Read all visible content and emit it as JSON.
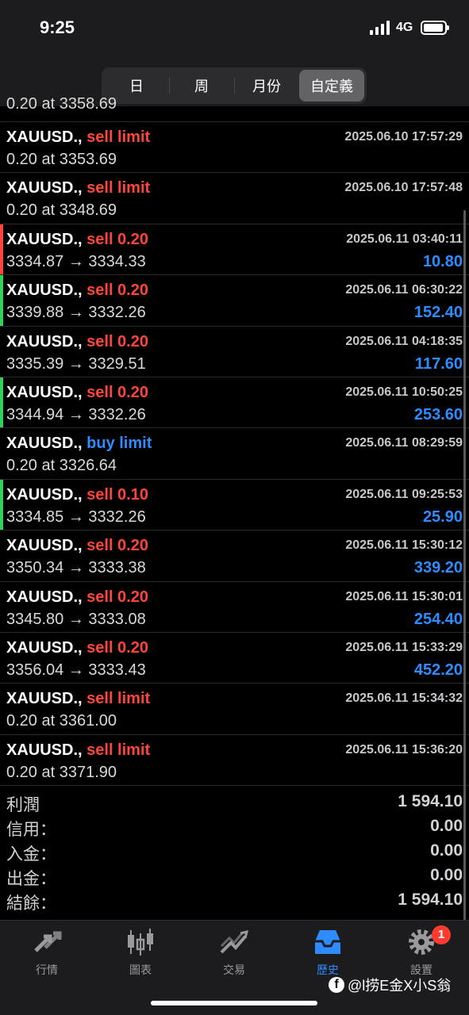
{
  "status_bar": {
    "time": "9:25",
    "network": "4G"
  },
  "segments": [
    {
      "label": "日",
      "active": false
    },
    {
      "label": "周",
      "active": false
    },
    {
      "label": "月份",
      "active": false
    },
    {
      "label": "自定義",
      "active": true
    }
  ],
  "partial_row": {
    "line2": "0.20 at 3358.69"
  },
  "rows": [
    {
      "symbol": "XAUUSD.,",
      "type": "sell limit",
      "type_color": "red",
      "time": "2025.06.10 17:57:29",
      "line2": "0.20 at 3353.69",
      "profit": "",
      "bar": ""
    },
    {
      "symbol": "XAUUSD.,",
      "type": "sell limit",
      "type_color": "red",
      "time": "2025.06.10 17:57:48",
      "line2": "0.20 at 3348.69",
      "profit": "",
      "bar": ""
    },
    {
      "symbol": "XAUUSD.,",
      "type": "sell 0.20",
      "type_color": "red",
      "time": "2025.06.11 03:40:11",
      "line2": "3334.87 → 3334.33",
      "profit": "10.80",
      "bar": "#ff453a"
    },
    {
      "symbol": "XAUUSD.,",
      "type": "sell 0.20",
      "type_color": "red",
      "time": "2025.06.11 06:30:22",
      "line2": "3339.88 → 3332.26",
      "profit": "152.40",
      "bar": "#30d158"
    },
    {
      "symbol": "XAUUSD.,",
      "type": "sell 0.20",
      "type_color": "red",
      "time": "2025.06.11 04:18:35",
      "line2": "3335.39 → 3329.51",
      "profit": "117.60",
      "bar": ""
    },
    {
      "symbol": "XAUUSD.,",
      "type": "sell 0.20",
      "type_color": "red",
      "time": "2025.06.11 10:50:25",
      "line2": "3344.94 → 3332.26",
      "profit": "253.60",
      "bar": "#30d158"
    },
    {
      "symbol": "XAUUSD.,",
      "type": "buy limit",
      "type_color": "blue",
      "time": "2025.06.11 08:29:59",
      "line2": "0.20 at 3326.64",
      "profit": "",
      "bar": ""
    },
    {
      "symbol": "XAUUSD.,",
      "type": "sell 0.10",
      "type_color": "red",
      "time": "2025.06.11 09:25:53",
      "line2": "3334.85 → 3332.26",
      "profit": "25.90",
      "bar": "#30d158"
    },
    {
      "symbol": "XAUUSD.,",
      "type": "sell 0.20",
      "type_color": "red",
      "time": "2025.06.11 15:30:12",
      "line2": "3350.34 → 3333.38",
      "profit": "339.20",
      "bar": ""
    },
    {
      "symbol": "XAUUSD.,",
      "type": "sell 0.20",
      "type_color": "red",
      "time": "2025.06.11 15:30:01",
      "line2": "3345.80 → 3333.08",
      "profit": "254.40",
      "bar": ""
    },
    {
      "symbol": "XAUUSD.,",
      "type": "sell 0.20",
      "type_color": "red",
      "time": "2025.06.11 15:33:29",
      "line2": "3356.04 → 3333.43",
      "profit": "452.20",
      "bar": ""
    },
    {
      "symbol": "XAUUSD.,",
      "type": "sell limit",
      "type_color": "red",
      "time": "2025.06.11 15:34:32",
      "line2": "0.20 at 3361.00",
      "profit": "",
      "bar": ""
    },
    {
      "symbol": "XAUUSD.,",
      "type": "sell limit",
      "type_color": "red",
      "time": "2025.06.11 15:36:20",
      "line2": "0.20 at 3371.90",
      "profit": "",
      "bar": ""
    }
  ],
  "summary": [
    {
      "label": "利潤",
      "value": "1 594.10"
    },
    {
      "label": "信用：",
      "value": "0.00"
    },
    {
      "label": "入金：",
      "value": "0.00"
    },
    {
      "label": "出金：",
      "value": "0.00"
    },
    {
      "label": "結餘：",
      "value": "1 594.10"
    }
  ],
  "tabs": [
    {
      "label": "行情",
      "icon": "quotes-arrows-icon",
      "active": false
    },
    {
      "label": "圖表",
      "icon": "candlestick-chart-icon",
      "active": false
    },
    {
      "label": "交易",
      "icon": "trade-trend-icon",
      "active": false
    },
    {
      "label": "歷史",
      "icon": "history-inbox-icon",
      "active": true
    },
    {
      "label": "設置",
      "icon": "gear-icon",
      "active": false,
      "badge": "1"
    }
  ],
  "watermark": {
    "fb": "f",
    "text": "@l捞E金X小S翁"
  },
  "colors": {
    "accent": "#2e8cff",
    "sell": "#ff453a",
    "win_bar": "#30d158",
    "loss_bar": "#ff453a"
  }
}
